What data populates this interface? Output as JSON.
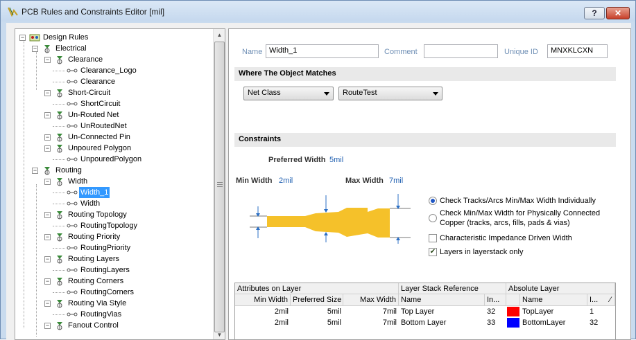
{
  "window": {
    "title": "PCB Rules and Constraints Editor [mil]",
    "help_label": "?",
    "close_label": "✕"
  },
  "tree": {
    "expander_minus": "−",
    "nodes": [
      {
        "label": "Design Rules",
        "level": 0,
        "icon": "design-rules-icon"
      },
      {
        "label": "Electrical",
        "level": 1,
        "icon": "category-icon"
      },
      {
        "label": "Clearance",
        "level": 2,
        "icon": "rule-type-icon"
      },
      {
        "label": "Clearance_Logo",
        "level": 3,
        "icon": "rule-icon"
      },
      {
        "label": "Clearance",
        "level": 3,
        "icon": "rule-icon"
      },
      {
        "label": "Short-Circuit",
        "level": 2,
        "icon": "rule-type-icon"
      },
      {
        "label": "ShortCircuit",
        "level": 3,
        "icon": "rule-icon"
      },
      {
        "label": "Un-Routed Net",
        "level": 2,
        "icon": "rule-type-icon"
      },
      {
        "label": "UnRoutedNet",
        "level": 3,
        "icon": "rule-icon"
      },
      {
        "label": "Un-Connected Pin",
        "level": 2,
        "icon": "rule-type-icon"
      },
      {
        "label": "Unpoured Polygon",
        "level": 2,
        "icon": "rule-type-icon"
      },
      {
        "label": "UnpouredPolygon",
        "level": 3,
        "icon": "rule-icon"
      },
      {
        "label": "Routing",
        "level": 1,
        "icon": "category-icon"
      },
      {
        "label": "Width",
        "level": 2,
        "icon": "rule-type-icon"
      },
      {
        "label": "Width_1",
        "level": 3,
        "icon": "rule-icon",
        "selected": true
      },
      {
        "label": "Width",
        "level": 3,
        "icon": "rule-icon"
      },
      {
        "label": "Routing Topology",
        "level": 2,
        "icon": "rule-type-icon"
      },
      {
        "label": "RoutingTopology",
        "level": 3,
        "icon": "rule-icon"
      },
      {
        "label": "Routing Priority",
        "level": 2,
        "icon": "rule-type-icon"
      },
      {
        "label": "RoutingPriority",
        "level": 3,
        "icon": "rule-icon"
      },
      {
        "label": "Routing Layers",
        "level": 2,
        "icon": "rule-type-icon"
      },
      {
        "label": "RoutingLayers",
        "level": 3,
        "icon": "rule-icon"
      },
      {
        "label": "Routing Corners",
        "level": 2,
        "icon": "rule-type-icon"
      },
      {
        "label": "RoutingCorners",
        "level": 3,
        "icon": "rule-icon"
      },
      {
        "label": "Routing Via Style",
        "level": 2,
        "icon": "rule-type-icon"
      },
      {
        "label": "RoutingVias",
        "level": 3,
        "icon": "rule-icon"
      },
      {
        "label": "Fanout Control",
        "level": 2,
        "icon": "rule-type-icon"
      }
    ]
  },
  "rule": {
    "name_label": "Name",
    "name_value": "Width_1",
    "comment_label": "Comment",
    "comment_value": "",
    "uid_label": "Unique ID",
    "uid_value": "MNXKLCXN"
  },
  "match": {
    "section_title": "Where The Object Matches",
    "combo1": "Net Class",
    "combo2": "RouteTest"
  },
  "constraints": {
    "section_title": "Constraints",
    "preferred_label": "Preferred Width",
    "preferred_value": "5mil",
    "min_label": "Min Width",
    "min_value": "2mil",
    "max_label": "Max Width",
    "max_value": "7mil",
    "opt1": "Check Tracks/Arcs Min/Max Width Individually",
    "opt2a": "Check Min/Max Width for Physically Connected",
    "opt2b": "Copper (tracks, arcs, fills, pads & vias)",
    "opt3": "Characteristic Impedance Driven Width",
    "opt4": "Layers in layerstack only",
    "opt1_selected": true,
    "opt3_checked": false,
    "opt4_checked": true
  },
  "grid": {
    "group1": "Attributes on Layer",
    "group2": "Layer Stack Reference",
    "group3": "Absolute Layer",
    "col_min": "Min Width",
    "col_pref": "Preferred Size",
    "col_max": "Max Width",
    "col_name": "Name",
    "col_index": "In...",
    "col_abs_name": "Name",
    "col_abs_index": "I...",
    "rows": [
      {
        "min": "2mil",
        "pref": "5mil",
        "max": "7mil",
        "name": "Top Layer",
        "index": "32",
        "abs_name": "TopLayer",
        "abs_index": "1",
        "color": "#ff0000"
      },
      {
        "min": "2mil",
        "pref": "5mil",
        "max": "7mil",
        "name": "Bottom Layer",
        "index": "33",
        "abs_name": "BottomLayer",
        "abs_index": "32",
        "color": "#0000ff"
      }
    ]
  },
  "colors": {
    "track": "#f5c12a",
    "selection": "#3399ff",
    "label_blue": "#6f8fb5"
  }
}
